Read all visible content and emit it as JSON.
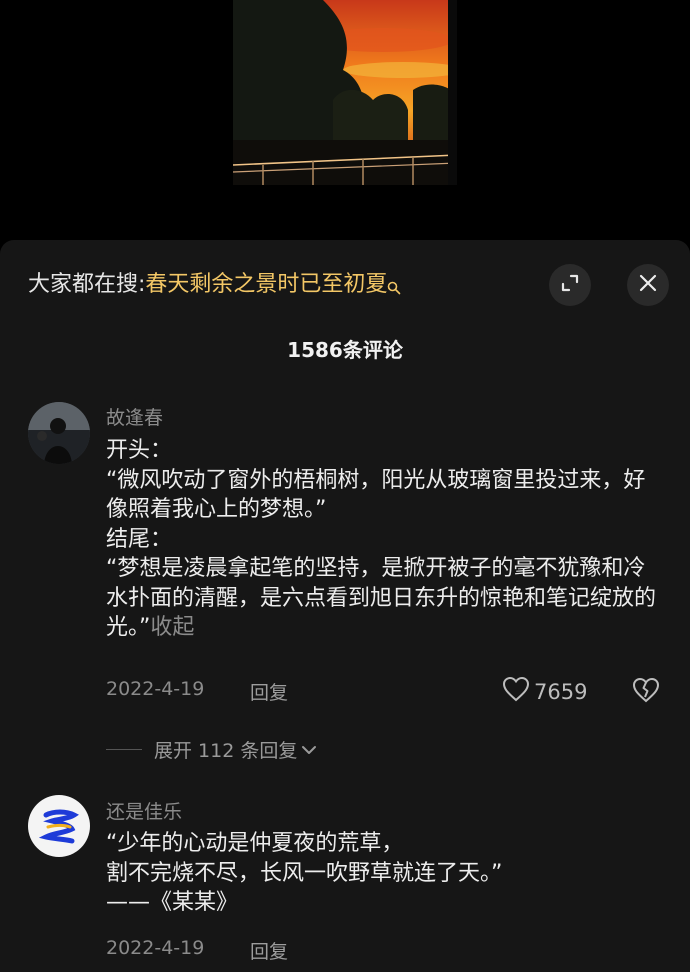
{
  "search": {
    "prefix": "大家都在搜:",
    "query": "春天剩余之景时已至初夏"
  },
  "comments_header": {
    "title": "1586条评论"
  },
  "comments": [
    {
      "username": "故逢春",
      "text": "开头：\n“微风吹动了窗外的梧桐树，阳光从玻璃窗里投过来，好像照着我心上的梦想。”\n结尾：\n“梦想是凌晨拿起笔的坚持，是掀开被子的毫不犹豫和冷水扑面的清醒，是六点看到旭日东升的惊艳和笔记绽放的光。”",
      "collapse_label": "收起",
      "date": "2022-4-19",
      "reply_label": "回复",
      "likes": "7659",
      "expand_replies_label": "展开 112 条回复"
    },
    {
      "username": "还是佳乐",
      "text": "“少年的心动是仲夏夜的荒草，\n割不完烧不尽，长风一吹野草就连了天。”\n——《某某》",
      "date": "2022-4-19",
      "reply_label": "回复"
    }
  ],
  "colors": {
    "sheet_background": "#161616",
    "search_highlight": "#f3c766",
    "muted_text": "#8b8b8b"
  },
  "icons": [
    "search-icon",
    "expand-icon",
    "close-icon",
    "heart-icon",
    "broken-heart-icon",
    "chevron-down-icon"
  ]
}
